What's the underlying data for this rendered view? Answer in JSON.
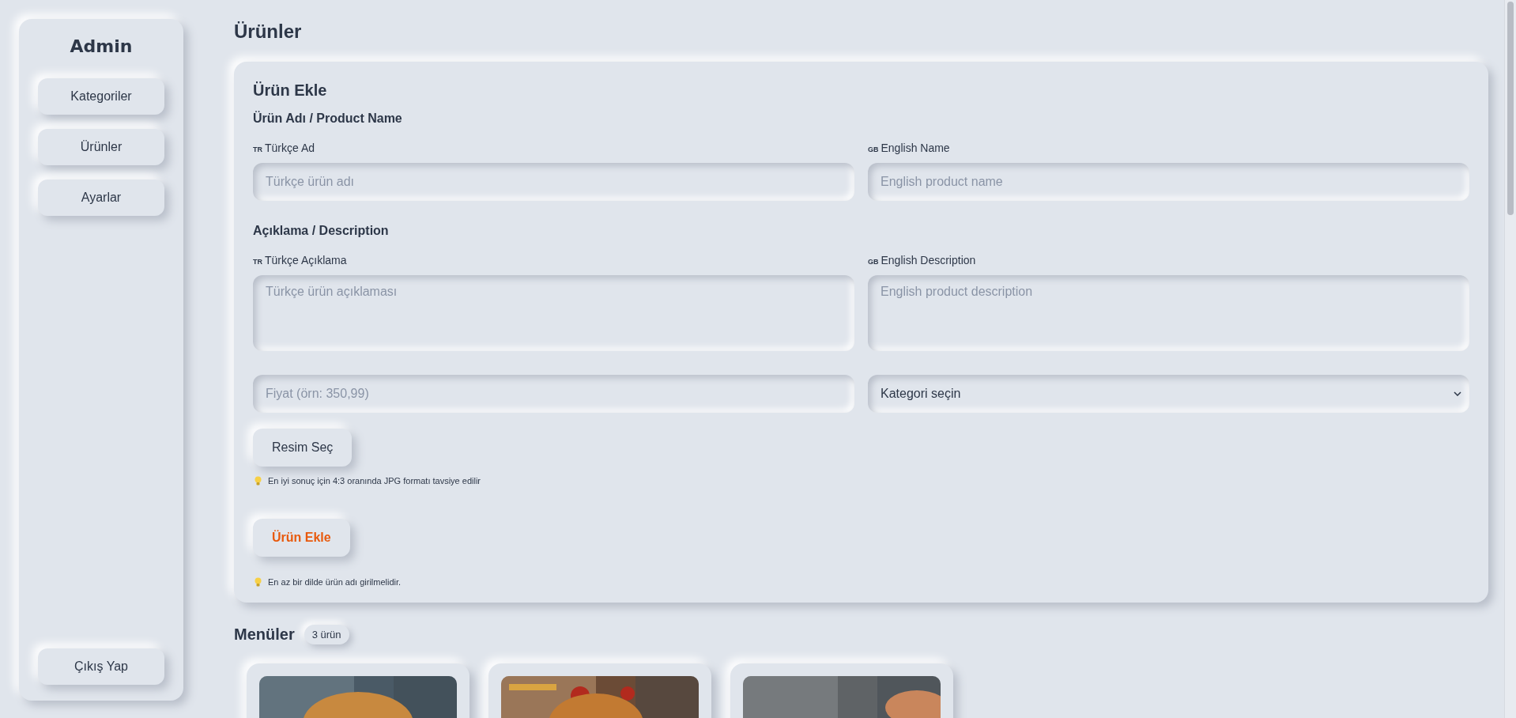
{
  "sidebar": {
    "title": "Admin",
    "items": [
      {
        "label": "Kategoriler"
      },
      {
        "label": "Ürünler"
      },
      {
        "label": "Ayarlar"
      }
    ],
    "logout": "Çıkış Yap"
  },
  "page_title": "Ürünler",
  "form": {
    "title": "Ürün Ekle",
    "sections": [
      {
        "heading": "Ürün Adı / Product Name",
        "fields": [
          {
            "kind": "input",
            "flag": "TR",
            "label": "Türkçe Ad",
            "placeholder": "Türkçe ürün adı"
          },
          {
            "kind": "input",
            "flag": "GB",
            "label": "English Name",
            "placeholder": "English product name"
          }
        ]
      },
      {
        "heading": "Açıklama / Description",
        "fields": [
          {
            "kind": "textarea",
            "flag": "TR",
            "label": "Türkçe Açıklama",
            "placeholder": "Türkçe ürün açıklaması"
          },
          {
            "kind": "textarea",
            "flag": "GB",
            "label": "English Description",
            "placeholder": "English product description"
          }
        ]
      }
    ],
    "price": {
      "placeholder": "Fiyat (örn: 350,99)"
    },
    "category": {
      "value": "Kategori seçin"
    },
    "image_button": "Resim Seç",
    "image_hint": "En iyi sonuç için 4:3 oranında JPG formatı tavsiye edilir",
    "submit_button": "Ürün Ekle",
    "submit_hint": "En az bir dilde ürün adı girilmelidir."
  },
  "products": {
    "heading": "Menüler",
    "count": "3 ürün"
  }
}
